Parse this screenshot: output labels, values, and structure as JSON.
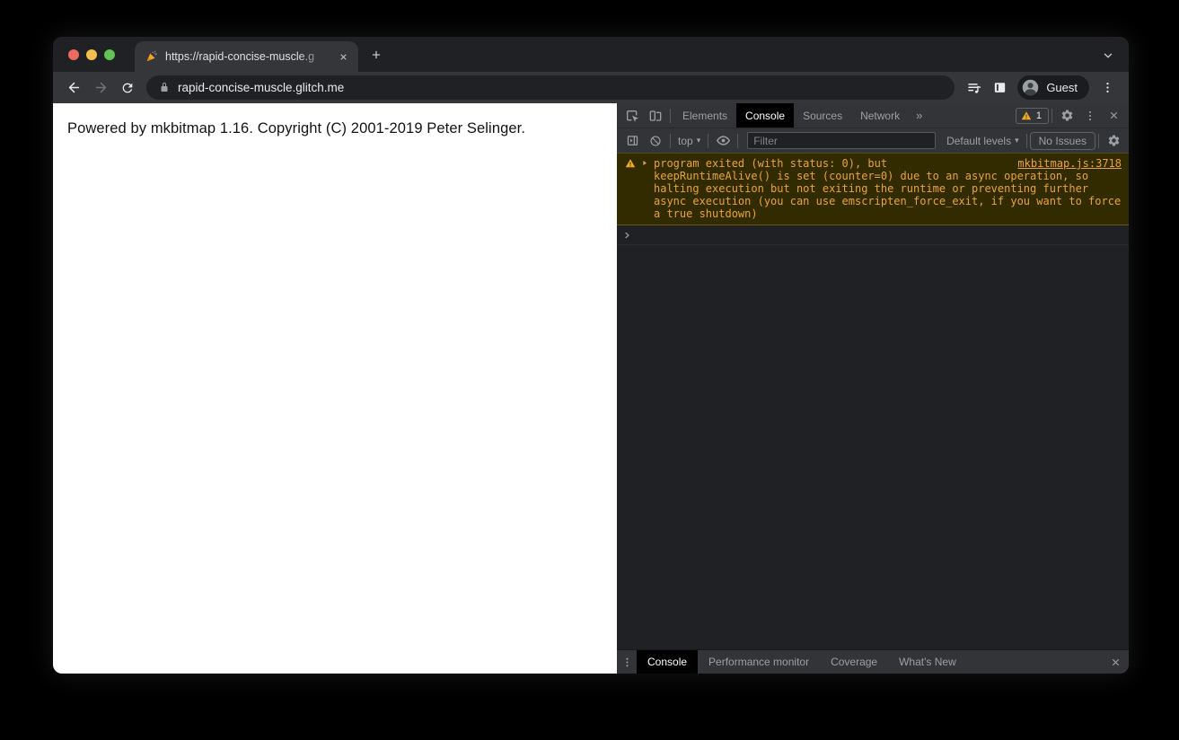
{
  "browser": {
    "tab_title": "https://rapid-concise-muscle.g",
    "tab_favicon": "party-popper",
    "url": "rapid-concise-muscle.glitch.me",
    "guest_label": "Guest"
  },
  "page": {
    "body_text": "Powered by mkbitmap 1.16. Copyright (C) 2001-2019 Peter Selinger."
  },
  "devtools": {
    "tabs": {
      "elements": "Elements",
      "console": "Console",
      "sources": "Sources",
      "network": "Network",
      "more": "»"
    },
    "warning_badge_count": "1",
    "toolbar": {
      "context_selector": "top",
      "caret": "▾",
      "filter_placeholder": "Filter",
      "levels_label": "Default levels",
      "issues_label": "No Issues"
    },
    "console": {
      "warning_text": "program exited (with status: 0), but keepRuntimeAlive() is set (counter=0) due to an async operation, so halting execution but not exiting the runtime or preventing further async execution (you can use emscripten_force_exit, if you want to force a true shutdown)",
      "warning_source": "mkbitmap.js:3718"
    },
    "drawer": {
      "tab_console": "Console",
      "tab_performance": "Performance monitor",
      "tab_coverage": "Coverage",
      "tab_whatsnew": "What's New"
    }
  },
  "colors": {
    "traffic_red": "#ed6a5e",
    "traffic_yellow": "#f5bf4f",
    "traffic_green": "#61c454",
    "warning_bg": "#332b00",
    "warning_text": "#e9a33b",
    "warning_icon": "#f2ab26",
    "devtools_toolbar_bg": "#333438",
    "console_bg": "#202124",
    "chrome_toolbar_bg": "#35363a"
  }
}
